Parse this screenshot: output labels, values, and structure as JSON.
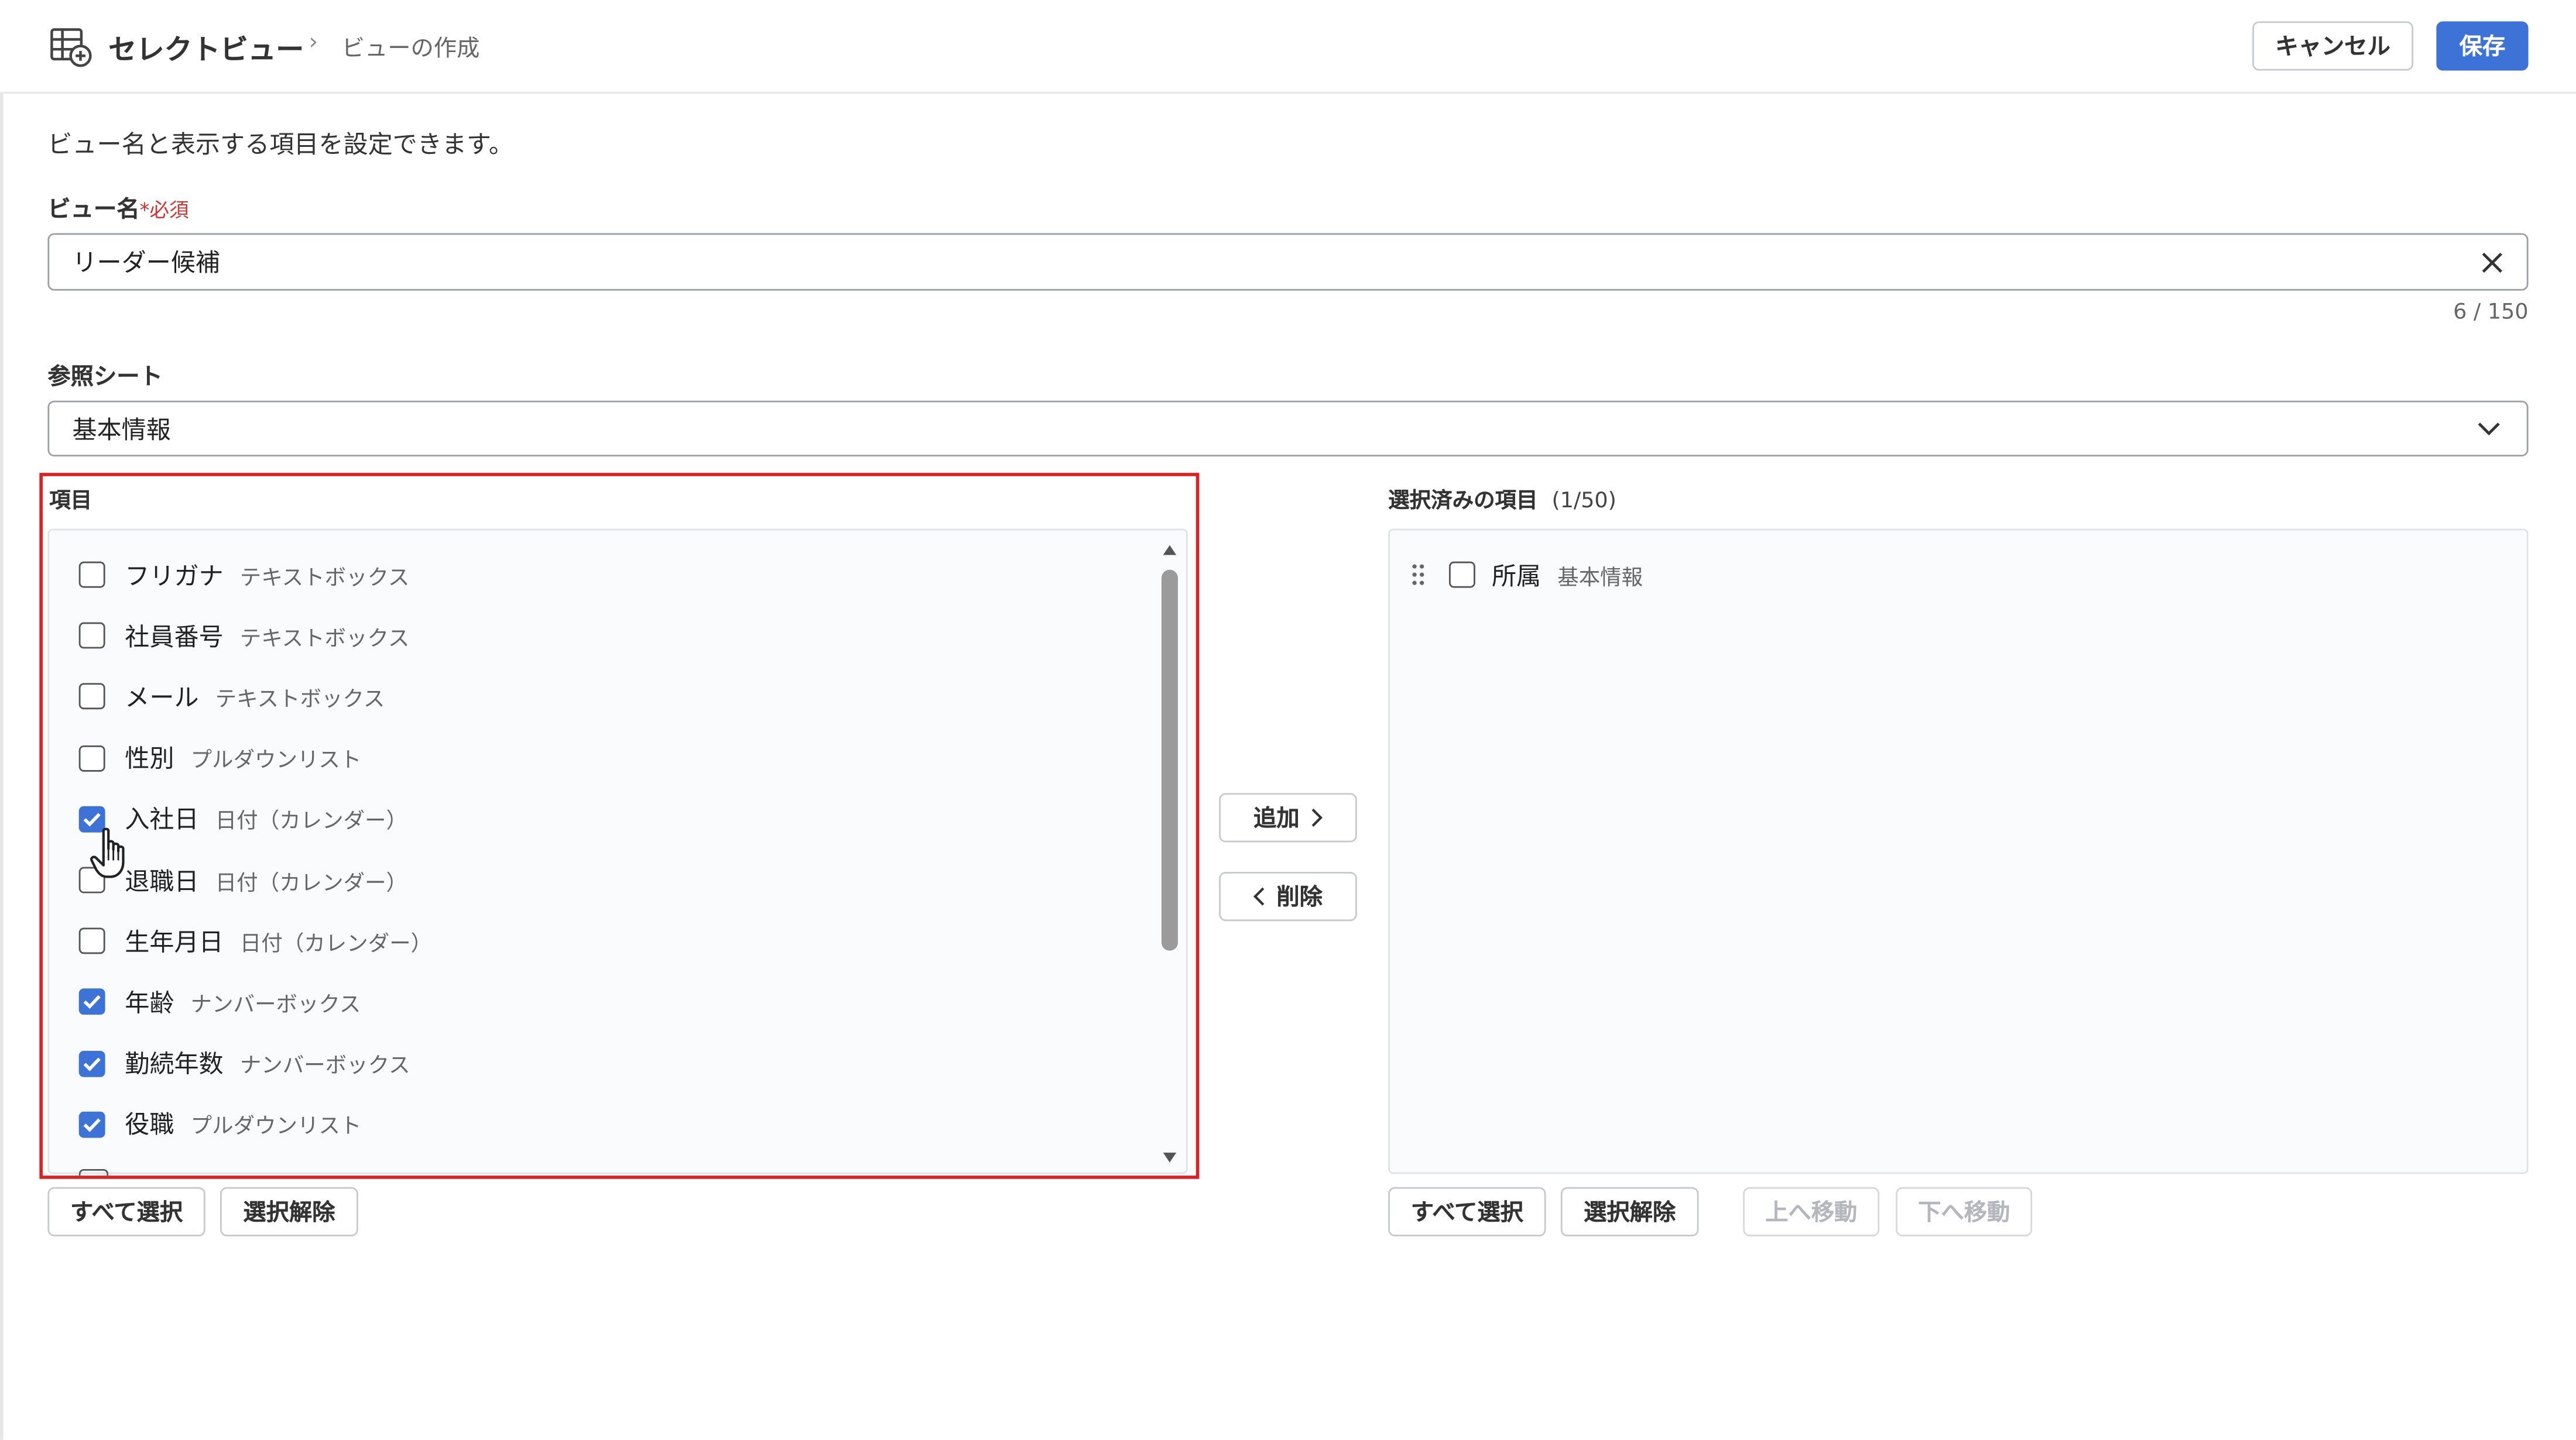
{
  "header": {
    "app_title": "セレクトビュー",
    "breadcrumb_sep": "›",
    "breadcrumb_page": "ビューの作成",
    "cancel_label": "キャンセル",
    "save_label": "保存"
  },
  "form": {
    "description": "ビュー名と表示する項目を設定できます。",
    "view_name_label": "ビュー名",
    "required_mark": "*必須",
    "view_name_value": "リーダー候補",
    "char_counter": "6 / 150",
    "sheet_label": "参照シート",
    "sheet_value": "基本情報"
  },
  "items_panel": {
    "title": "項目",
    "items": [
      {
        "name": "フリガナ",
        "type": "テキストボックス",
        "checked": false
      },
      {
        "name": "社員番号",
        "type": "テキストボックス",
        "checked": false
      },
      {
        "name": "メール",
        "type": "テキストボックス",
        "checked": false
      },
      {
        "name": "性別",
        "type": "プルダウンリスト",
        "checked": false
      },
      {
        "name": "入社日",
        "type": "日付（カレンダー）",
        "checked": true
      },
      {
        "name": "退職日",
        "type": "日付（カレンダー）",
        "checked": false
      },
      {
        "name": "生年月日",
        "type": "日付（カレンダー）",
        "checked": false
      },
      {
        "name": "年齢",
        "type": "ナンバーボックス",
        "checked": true
      },
      {
        "name": "勤続年数",
        "type": "ナンバーボックス",
        "checked": true
      },
      {
        "name": "役職",
        "type": "プルダウンリスト",
        "checked": true
      }
    ],
    "select_all_label": "すべて選択",
    "deselect_label": "選択解除"
  },
  "transfer": {
    "add_label": "追加",
    "remove_label": "削除"
  },
  "selected_panel": {
    "title": "選択済みの項目",
    "count": "(1/50)",
    "items": [
      {
        "name": "所属",
        "type": "基本情報",
        "checked": false
      }
    ],
    "select_all_label": "すべて選択",
    "deselect_label": "選択解除",
    "move_up_label": "上へ移動",
    "move_down_label": "下へ移動"
  },
  "icons": {
    "app": "table-plus-icon",
    "clear": "close-icon",
    "dropdown": "chevron-down-icon",
    "drag": "drag-handle-icon",
    "cursor": "hand-pointer-icon"
  },
  "colors": {
    "accent": "#3d73d6",
    "highlight_frame": "#e02020",
    "required": "#d3332f"
  }
}
